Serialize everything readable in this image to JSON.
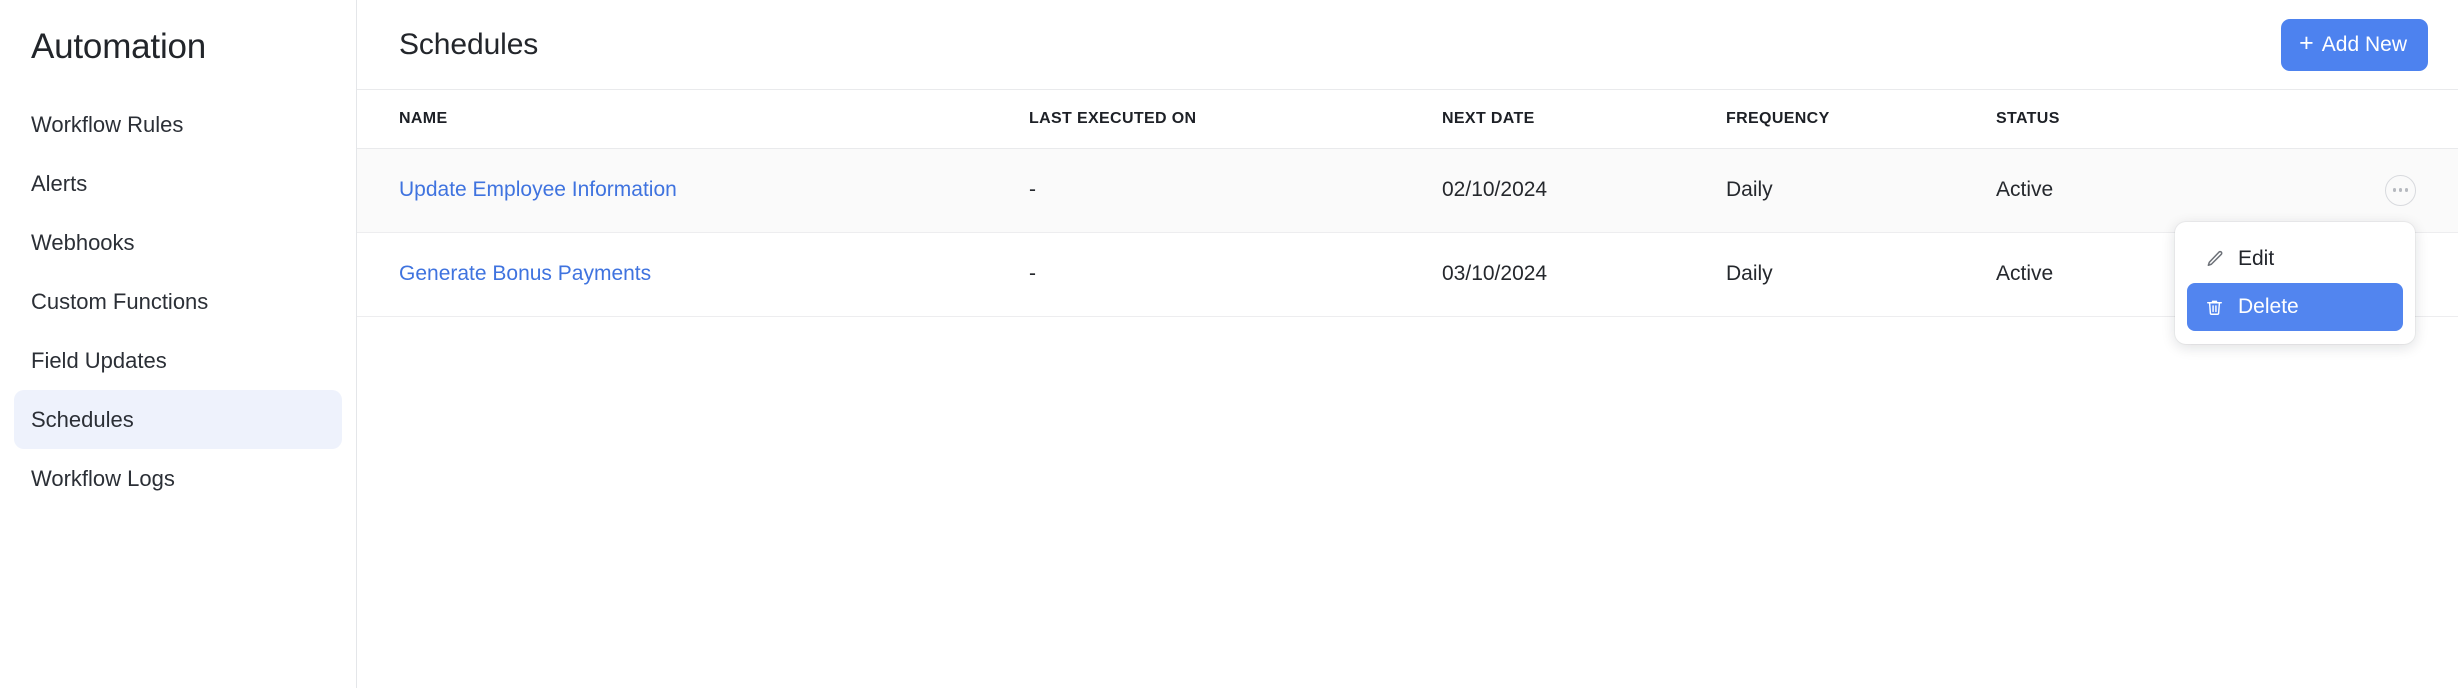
{
  "sidebar": {
    "title": "Automation",
    "items": [
      {
        "label": "Workflow Rules",
        "active": false
      },
      {
        "label": "Alerts",
        "active": false
      },
      {
        "label": "Webhooks",
        "active": false
      },
      {
        "label": "Custom Functions",
        "active": false
      },
      {
        "label": "Field Updates",
        "active": false
      },
      {
        "label": "Schedules",
        "active": true
      },
      {
        "label": "Workflow Logs",
        "active": false
      }
    ]
  },
  "header": {
    "title": "Schedules",
    "add_button": {
      "label": "Add New",
      "icon": "plus-icon",
      "color": "#4d82ef"
    }
  },
  "table": {
    "columns": [
      "NAME",
      "LAST EXECUTED ON",
      "NEXT DATE",
      "FREQUENCY",
      "STATUS"
    ],
    "rows": [
      {
        "name": "Update Employee Information",
        "last_executed_on": "-",
        "next_date": "02/10/2024",
        "frequency": "Daily",
        "status": "Active",
        "actions_icon": "ellipsis-icon"
      },
      {
        "name": "Generate Bonus Payments",
        "last_executed_on": "-",
        "next_date": "03/10/2024",
        "frequency": "Daily",
        "status": "Active"
      }
    ]
  },
  "dropdown": {
    "visible": true,
    "items": [
      {
        "label": "Edit",
        "icon": "pencil-icon",
        "selected": false
      },
      {
        "label": "Delete",
        "icon": "trash-icon",
        "selected": true
      }
    ],
    "highlight_color": "#5285ef"
  },
  "colors": {
    "accent": "#4d82ef",
    "link": "#3f73df",
    "sidebar_active_bg": "#eef2fc",
    "row_hover_bg": "#fafafa",
    "border": "#e9eaec"
  }
}
